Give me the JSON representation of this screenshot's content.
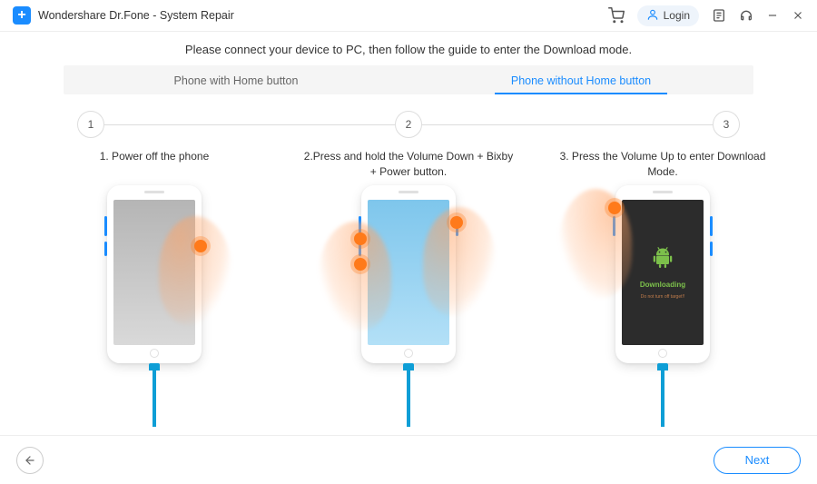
{
  "app": {
    "title": "Wondershare Dr.Fone - System Repair",
    "login_label": "Login"
  },
  "instruction": "Please connect your device to PC, then follow the guide to enter the Download mode.",
  "tabs": {
    "home": "Phone with Home button",
    "no_home": "Phone without Home button",
    "active_index": 1
  },
  "steps": {
    "nums": [
      "1",
      "2",
      "3"
    ],
    "labels": [
      "1. Power off the phone",
      "2.Press and hold the Volume Down + Bixby + Power button.",
      "3. Press the Volume Up to enter Download Mode."
    ]
  },
  "download_screen": {
    "title": "Downloading",
    "subtitle": "Do not turn off target!!"
  },
  "footer": {
    "next": "Next"
  }
}
